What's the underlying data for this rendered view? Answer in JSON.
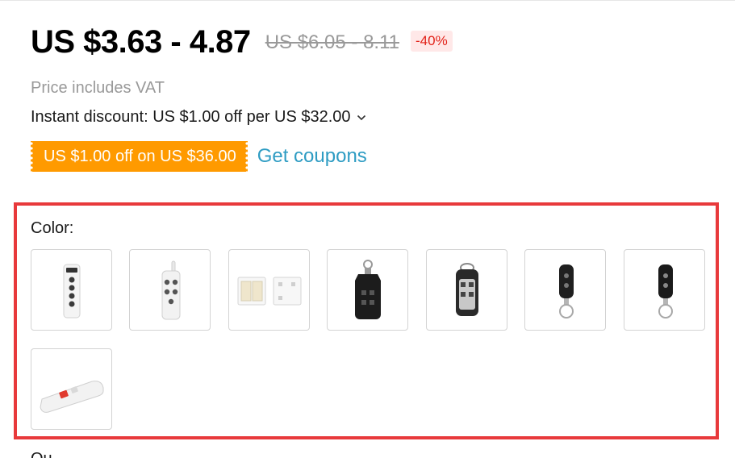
{
  "price": {
    "current": "US $3.63 - 4.87",
    "original": "US $6.05 - 8.11",
    "discount_badge": "-40%"
  },
  "vat_note": "Price includes VAT",
  "instant_discount": {
    "text": "Instant discount: US $1.00 off per US $32.00",
    "icon": "chevron-down-icon"
  },
  "coupon": {
    "tag_label": "US $1.00 off on US $36.00",
    "link_label": "Get coupons"
  },
  "color_section": {
    "label": "Color:",
    "options": [
      {
        "name": "white-4-button-remote"
      },
      {
        "name": "white-4-button-remote-antenna"
      },
      {
        "name": "white-wall-switch-panels"
      },
      {
        "name": "black-4-button-keyfob"
      },
      {
        "name": "black-silver-4-button-keyfob"
      },
      {
        "name": "black-2-button-keyfob"
      },
      {
        "name": "black-2-button-keyfob-alt"
      },
      {
        "name": "white-long-range-remote"
      }
    ]
  },
  "next_section_label": "Qu..."
}
